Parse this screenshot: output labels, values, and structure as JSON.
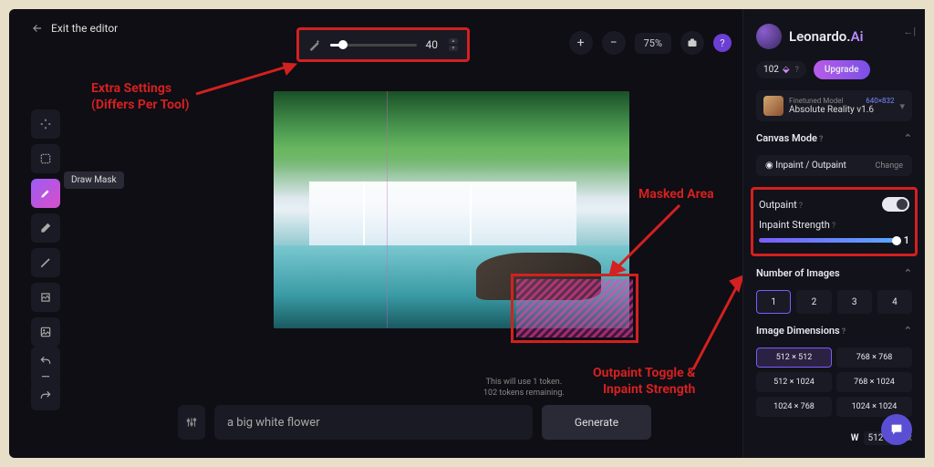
{
  "header": {
    "exit": "Exit the editor",
    "zoom": "75%",
    "extra_value": "40"
  },
  "tooltip": "Draw Mask",
  "annotations": {
    "extra": "Extra Settings\n(Differs Per Tool)",
    "masked": "Masked Area",
    "outpaint": "Outpaint Toggle &\nInpaint Strength"
  },
  "tokens": {
    "line1": "This will use 1 token.",
    "line2": "102 tokens remaining."
  },
  "prompt": {
    "value": "a big white flower",
    "generate": "Generate"
  },
  "sidebar": {
    "brand_a": "Leonardo.",
    "brand_b": "Ai",
    "token_count": "102",
    "upgrade": "Upgrade",
    "model_sub": "Finetuned Model",
    "model_dim": "640×832",
    "model_name": "Absolute Reality v1.6",
    "canvas_mode": "Canvas Mode",
    "inpaint_out": "Inpaint / Outpaint",
    "change": "Change",
    "outpaint": "Outpaint",
    "strength": "Inpaint Strength",
    "strength_val": "1",
    "num_images": "Number of Images",
    "nums": [
      "1",
      "2",
      "3",
      "4"
    ],
    "dims_label": "Image Dimensions",
    "dims": [
      "512 × 512",
      "768 × 768",
      "512 × 1024",
      "768 × 1024",
      "1024 × 768",
      "1024 × 1024"
    ],
    "w_label": "W",
    "w_val": "512",
    "w_unit": "px"
  }
}
